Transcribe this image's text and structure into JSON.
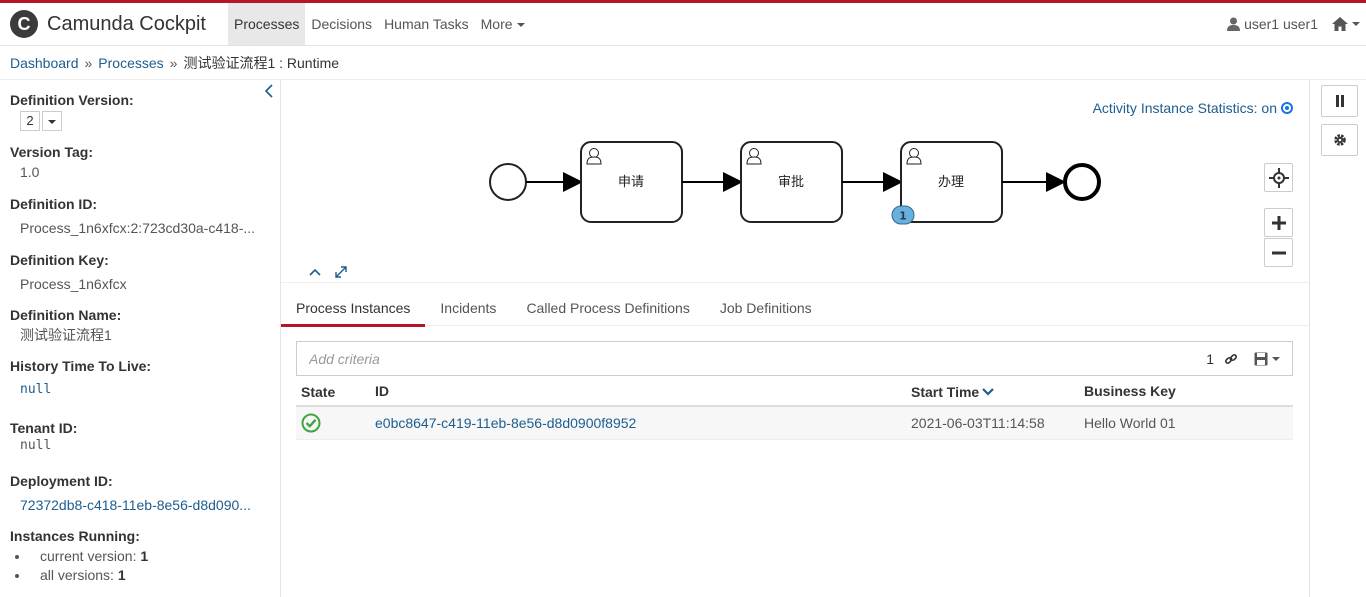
{
  "header": {
    "app_name": "Camunda Cockpit",
    "logo_letter": "C",
    "nav": [
      {
        "label": "Processes",
        "active": true
      },
      {
        "label": "Decisions",
        "active": false
      },
      {
        "label": "Human Tasks",
        "active": false
      },
      {
        "label": "More",
        "active": false
      }
    ],
    "user": "user1 user1",
    "brand_color": "#b5152b"
  },
  "breadcrumb": {
    "items": [
      "Dashboard",
      "Processes"
    ],
    "separator": "»",
    "current": "测试验证流程1 : Runtime"
  },
  "sidebar": {
    "definition_version": {
      "label": "Definition Version:",
      "value": "2"
    },
    "version_tag": {
      "label": "Version Tag:",
      "value": "1.0"
    },
    "definition_id": {
      "label": "Definition ID:",
      "value": "Process_1n6xfcx:2:723cd30a-c418-..."
    },
    "definition_key": {
      "label": "Definition Key:",
      "value": "Process_1n6xfcx"
    },
    "definition_name": {
      "label": "Definition Name:",
      "value": "测试验证流程1"
    },
    "history_ttl": {
      "label": "History Time To Live:",
      "value": "null"
    },
    "tenant_id": {
      "label": "Tenant ID:",
      "value": "null"
    },
    "deployment_id": {
      "label": "Deployment ID:",
      "value": "72372db8-c418-11eb-8e56-d8d090..."
    },
    "instances_running": {
      "label": "Instances Running:",
      "current_label": "current version:",
      "current_value": "1",
      "all_label": "all versions:",
      "all_value": "1"
    }
  },
  "diagram": {
    "stats_label": "Activity Instance Statistics: on",
    "tasks": [
      {
        "name": "申请"
      },
      {
        "name": "审批"
      },
      {
        "name": "办理",
        "badge": "1"
      }
    ]
  },
  "tabs": [
    {
      "label": "Process Instances",
      "active": true
    },
    {
      "label": "Incidents",
      "active": false
    },
    {
      "label": "Called Process Definitions",
      "active": false
    },
    {
      "label": "Job Definitions",
      "active": false
    }
  ],
  "search": {
    "placeholder": "Add criteria",
    "count": "1"
  },
  "table": {
    "columns": [
      "State",
      "ID",
      "Start Time",
      "Business Key"
    ],
    "rows": [
      {
        "state": "ok-icon",
        "id": "e0bc8647-c419-11eb-8e56-d8d0900f8952",
        "start_time": "2021-06-03T11:14:58",
        "business_key": "Hello World 01"
      }
    ]
  }
}
